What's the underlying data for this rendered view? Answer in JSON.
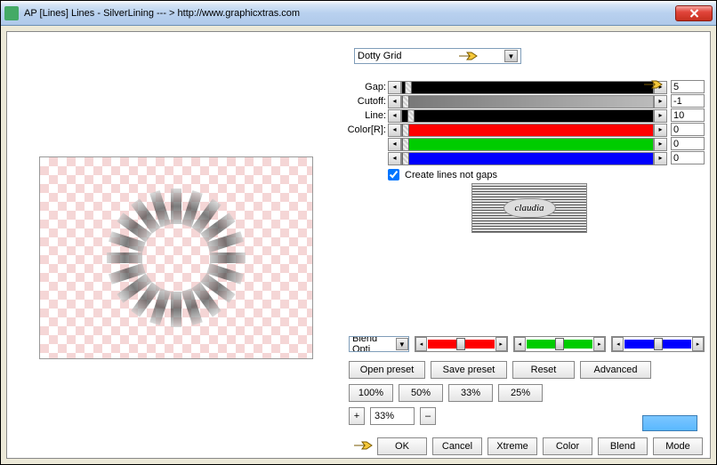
{
  "window": {
    "title": "AP [Lines]  Lines - SilverLining   --- >  http://www.graphicxtras.com"
  },
  "preset": {
    "selected": "Dotty Grid"
  },
  "slider_labels": [
    "Gap:",
    "Cutoff:",
    "Line:",
    "Color[R]:"
  ],
  "sliders": [
    {
      "val": "5",
      "bar_color": "#000",
      "bar_width": "100%",
      "thumb_left": "1%",
      "track_bg": "#e8e8e8"
    },
    {
      "val": "-1",
      "bar_color": "rgba(0,0,0,0)",
      "bar_width": "0%",
      "thumb_left": "0%",
      "track_bg": "linear-gradient(90deg,#777,#bbb)"
    },
    {
      "val": "10",
      "bar_color": "#000",
      "bar_width": "100%",
      "thumb_left": "2%",
      "track_bg": "#e8e8e8"
    },
    {
      "val": "0",
      "bar_color": "#f00",
      "bar_width": "100%",
      "thumb_left": "0%",
      "track_bg": "#e8e8e8"
    },
    {
      "val": "0",
      "bar_color": "#0c0",
      "bar_width": "100%",
      "thumb_left": "0%",
      "track_bg": "#e8e8e8"
    },
    {
      "val": "0",
      "bar_color": "#00f",
      "bar_width": "100%",
      "thumb_left": "0%",
      "track_bg": "#e8e8e8"
    }
  ],
  "checkbox": {
    "label": "Create lines not gaps",
    "checked": true
  },
  "logo": "claudia",
  "blend": {
    "selected": "Blend Opti"
  },
  "rgb_sliders": [
    {
      "color": "#f00"
    },
    {
      "color": "#0c0"
    },
    {
      "color": "#00f"
    }
  ],
  "row1": {
    "b1": "Open preset",
    "b2": "Save preset",
    "b3": "Reset",
    "b4": "Advanced"
  },
  "row2": {
    "b1": "100%",
    "b2": "50%",
    "b3": "33%",
    "b4": "25%"
  },
  "zoom": {
    "plus": "+",
    "val": "33%",
    "minus": "–"
  },
  "row3": {
    "b1": "OK",
    "b2": "Cancel",
    "b3": "Xtreme",
    "b4": "Color",
    "b5": "Blend",
    "b6": "Mode"
  }
}
